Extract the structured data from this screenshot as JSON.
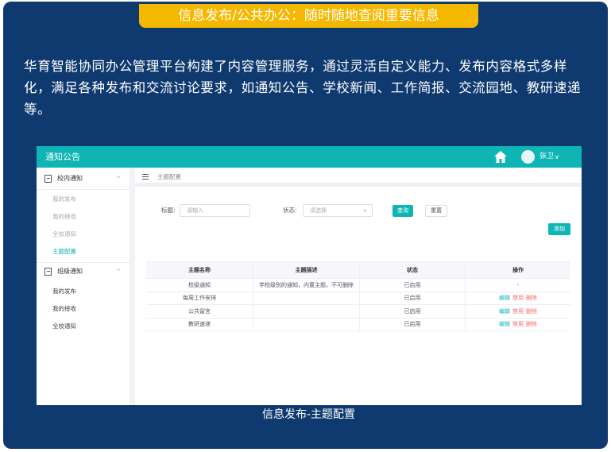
{
  "banner": {
    "title": "信息发布/公共办公：随时随地查阅重要信息"
  },
  "intro": "华育智能协同办公管理平台构建了内容管理服务，通过灵活自定义能力、发布内容格式多样化，满足各种发布和交流讨论要求，如通知公告、学校新闻、工作简报、交流园地、教研速递等。",
  "caption": "信息发布-主题配置",
  "app": {
    "title": "通知公告",
    "user": {
      "name": "张卫",
      "caret": "∨"
    },
    "sidebar": {
      "groups": [
        {
          "label": "校内通知",
          "caret": "^",
          "items": [
            "我的发布",
            "我的接收",
            "全校通知",
            "主题配置"
          ]
        },
        {
          "label": "班级通知",
          "caret": "^",
          "items": [
            "我的发布",
            "我的接收",
            "全校通知"
          ]
        }
      ]
    },
    "breadcrumb": "主题配置",
    "filters": {
      "title_label": "标题:",
      "title_placeholder": "请输入",
      "status_label": "状态:",
      "status_placeholder": "请选择",
      "query_button": "查询",
      "reset_button": "重置",
      "add_button": "添加"
    },
    "table": {
      "headers": [
        "主题名称",
        "主题描述",
        "状态",
        "操作"
      ],
      "rows": [
        {
          "name": "校级通知",
          "desc": "学校级别的通知，内置主题，不可删除",
          "status": "已启用",
          "actions": [
            "-"
          ]
        },
        {
          "name": "每周工作安排",
          "desc": "",
          "status": "已启用",
          "actions": [
            "编辑",
            "禁用",
            "删除"
          ]
        },
        {
          "name": "公共留言",
          "desc": "",
          "status": "已启用",
          "actions": [
            "编辑",
            "禁用",
            "删除"
          ]
        },
        {
          "name": "教研速递",
          "desc": "",
          "status": "已启用",
          "actions": [
            "编辑",
            "禁用",
            "删除"
          ]
        }
      ]
    }
  },
  "colors": {
    "card": "#0f3a6f",
    "banner": "#f5b800",
    "accent": "#0fb5b5",
    "danger": "#f56c6c"
  },
  "icons": {
    "home": "home-icon",
    "avatar": "avatar",
    "menu": "menu-icon",
    "group": "document-icon"
  }
}
